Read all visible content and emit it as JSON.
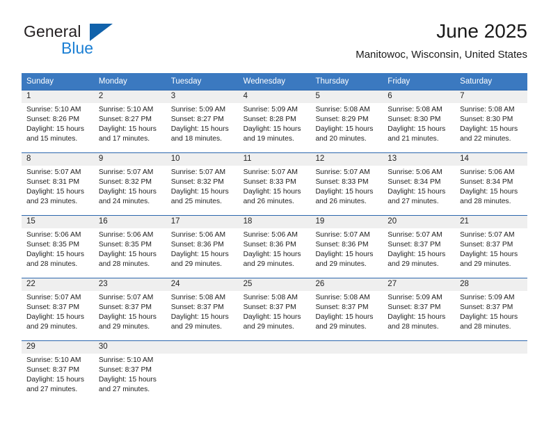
{
  "brand": {
    "name_top": "General",
    "name_bottom": "Blue",
    "triangle_color": "#1162ab",
    "blue_text_color": "#1b7fd4"
  },
  "header": {
    "title": "June 2025",
    "subtitle": "Manitowoc, Wisconsin, United States"
  },
  "theme": {
    "header_bar": "#3b79c0",
    "row_divider": "#2b66ad",
    "daynum_strip": "#efefef",
    "text": "#1d1d1d"
  },
  "weekdays": [
    "Sunday",
    "Monday",
    "Tuesday",
    "Wednesday",
    "Thursday",
    "Friday",
    "Saturday"
  ],
  "weeks": [
    [
      {
        "day": "1",
        "sunrise": "Sunrise: 5:10 AM",
        "sunset": "Sunset: 8:26 PM",
        "daylight1": "Daylight: 15 hours",
        "daylight2": "and 15 minutes."
      },
      {
        "day": "2",
        "sunrise": "Sunrise: 5:10 AM",
        "sunset": "Sunset: 8:27 PM",
        "daylight1": "Daylight: 15 hours",
        "daylight2": "and 17 minutes."
      },
      {
        "day": "3",
        "sunrise": "Sunrise: 5:09 AM",
        "sunset": "Sunset: 8:27 PM",
        "daylight1": "Daylight: 15 hours",
        "daylight2": "and 18 minutes."
      },
      {
        "day": "4",
        "sunrise": "Sunrise: 5:09 AM",
        "sunset": "Sunset: 8:28 PM",
        "daylight1": "Daylight: 15 hours",
        "daylight2": "and 19 minutes."
      },
      {
        "day": "5",
        "sunrise": "Sunrise: 5:08 AM",
        "sunset": "Sunset: 8:29 PM",
        "daylight1": "Daylight: 15 hours",
        "daylight2": "and 20 minutes."
      },
      {
        "day": "6",
        "sunrise": "Sunrise: 5:08 AM",
        "sunset": "Sunset: 8:30 PM",
        "daylight1": "Daylight: 15 hours",
        "daylight2": "and 21 minutes."
      },
      {
        "day": "7",
        "sunrise": "Sunrise: 5:08 AM",
        "sunset": "Sunset: 8:30 PM",
        "daylight1": "Daylight: 15 hours",
        "daylight2": "and 22 minutes."
      }
    ],
    [
      {
        "day": "8",
        "sunrise": "Sunrise: 5:07 AM",
        "sunset": "Sunset: 8:31 PM",
        "daylight1": "Daylight: 15 hours",
        "daylight2": "and 23 minutes."
      },
      {
        "day": "9",
        "sunrise": "Sunrise: 5:07 AM",
        "sunset": "Sunset: 8:32 PM",
        "daylight1": "Daylight: 15 hours",
        "daylight2": "and 24 minutes."
      },
      {
        "day": "10",
        "sunrise": "Sunrise: 5:07 AM",
        "sunset": "Sunset: 8:32 PM",
        "daylight1": "Daylight: 15 hours",
        "daylight2": "and 25 minutes."
      },
      {
        "day": "11",
        "sunrise": "Sunrise: 5:07 AM",
        "sunset": "Sunset: 8:33 PM",
        "daylight1": "Daylight: 15 hours",
        "daylight2": "and 26 minutes."
      },
      {
        "day": "12",
        "sunrise": "Sunrise: 5:07 AM",
        "sunset": "Sunset: 8:33 PM",
        "daylight1": "Daylight: 15 hours",
        "daylight2": "and 26 minutes."
      },
      {
        "day": "13",
        "sunrise": "Sunrise: 5:06 AM",
        "sunset": "Sunset: 8:34 PM",
        "daylight1": "Daylight: 15 hours",
        "daylight2": "and 27 minutes."
      },
      {
        "day": "14",
        "sunrise": "Sunrise: 5:06 AM",
        "sunset": "Sunset: 8:34 PM",
        "daylight1": "Daylight: 15 hours",
        "daylight2": "and 28 minutes."
      }
    ],
    [
      {
        "day": "15",
        "sunrise": "Sunrise: 5:06 AM",
        "sunset": "Sunset: 8:35 PM",
        "daylight1": "Daylight: 15 hours",
        "daylight2": "and 28 minutes."
      },
      {
        "day": "16",
        "sunrise": "Sunrise: 5:06 AM",
        "sunset": "Sunset: 8:35 PM",
        "daylight1": "Daylight: 15 hours",
        "daylight2": "and 28 minutes."
      },
      {
        "day": "17",
        "sunrise": "Sunrise: 5:06 AM",
        "sunset": "Sunset: 8:36 PM",
        "daylight1": "Daylight: 15 hours",
        "daylight2": "and 29 minutes."
      },
      {
        "day": "18",
        "sunrise": "Sunrise: 5:06 AM",
        "sunset": "Sunset: 8:36 PM",
        "daylight1": "Daylight: 15 hours",
        "daylight2": "and 29 minutes."
      },
      {
        "day": "19",
        "sunrise": "Sunrise: 5:07 AM",
        "sunset": "Sunset: 8:36 PM",
        "daylight1": "Daylight: 15 hours",
        "daylight2": "and 29 minutes."
      },
      {
        "day": "20",
        "sunrise": "Sunrise: 5:07 AM",
        "sunset": "Sunset: 8:37 PM",
        "daylight1": "Daylight: 15 hours",
        "daylight2": "and 29 minutes."
      },
      {
        "day": "21",
        "sunrise": "Sunrise: 5:07 AM",
        "sunset": "Sunset: 8:37 PM",
        "daylight1": "Daylight: 15 hours",
        "daylight2": "and 29 minutes."
      }
    ],
    [
      {
        "day": "22",
        "sunrise": "Sunrise: 5:07 AM",
        "sunset": "Sunset: 8:37 PM",
        "daylight1": "Daylight: 15 hours",
        "daylight2": "and 29 minutes."
      },
      {
        "day": "23",
        "sunrise": "Sunrise: 5:07 AM",
        "sunset": "Sunset: 8:37 PM",
        "daylight1": "Daylight: 15 hours",
        "daylight2": "and 29 minutes."
      },
      {
        "day": "24",
        "sunrise": "Sunrise: 5:08 AM",
        "sunset": "Sunset: 8:37 PM",
        "daylight1": "Daylight: 15 hours",
        "daylight2": "and 29 minutes."
      },
      {
        "day": "25",
        "sunrise": "Sunrise: 5:08 AM",
        "sunset": "Sunset: 8:37 PM",
        "daylight1": "Daylight: 15 hours",
        "daylight2": "and 29 minutes."
      },
      {
        "day": "26",
        "sunrise": "Sunrise: 5:08 AM",
        "sunset": "Sunset: 8:37 PM",
        "daylight1": "Daylight: 15 hours",
        "daylight2": "and 29 minutes."
      },
      {
        "day": "27",
        "sunrise": "Sunrise: 5:09 AM",
        "sunset": "Sunset: 8:37 PM",
        "daylight1": "Daylight: 15 hours",
        "daylight2": "and 28 minutes."
      },
      {
        "day": "28",
        "sunrise": "Sunrise: 5:09 AM",
        "sunset": "Sunset: 8:37 PM",
        "daylight1": "Daylight: 15 hours",
        "daylight2": "and 28 minutes."
      }
    ],
    [
      {
        "day": "29",
        "sunrise": "Sunrise: 5:10 AM",
        "sunset": "Sunset: 8:37 PM",
        "daylight1": "Daylight: 15 hours",
        "daylight2": "and 27 minutes."
      },
      {
        "day": "30",
        "sunrise": "Sunrise: 5:10 AM",
        "sunset": "Sunset: 8:37 PM",
        "daylight1": "Daylight: 15 hours",
        "daylight2": "and 27 minutes."
      },
      {
        "day": "",
        "sunrise": "",
        "sunset": "",
        "daylight1": "",
        "daylight2": ""
      },
      {
        "day": "",
        "sunrise": "",
        "sunset": "",
        "daylight1": "",
        "daylight2": ""
      },
      {
        "day": "",
        "sunrise": "",
        "sunset": "",
        "daylight1": "",
        "daylight2": ""
      },
      {
        "day": "",
        "sunrise": "",
        "sunset": "",
        "daylight1": "",
        "daylight2": ""
      },
      {
        "day": "",
        "sunrise": "",
        "sunset": "",
        "daylight1": "",
        "daylight2": ""
      }
    ]
  ]
}
